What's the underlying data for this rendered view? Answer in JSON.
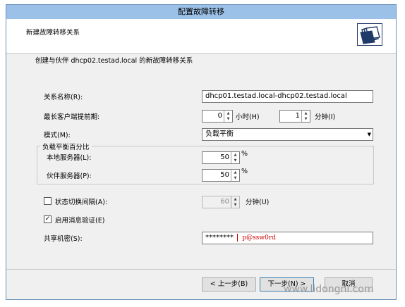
{
  "window": {
    "title": "配置故障转移"
  },
  "header": {
    "title": "新建故障转移关系",
    "icon": "folders-icon"
  },
  "description": "创建与伙伴 dhcp02.testad.local 的新故障转移关系",
  "relationship": {
    "label": "关系名称(R):",
    "value": "dhcp01.testad.local-dhcp02.testad.local"
  },
  "mclt": {
    "label": "最长客户端提前期:",
    "hours": "0",
    "hours_label": "小时(H)",
    "minutes": "1",
    "minutes_label": "分钟(I)"
  },
  "mode": {
    "label": "模式(M):",
    "value": "负载平衡"
  },
  "load_balance": {
    "title": "负载平衡百分比",
    "local_label": "本地服务器(L):",
    "local_value": "50",
    "partner_label": "伙伴服务器(P):",
    "partner_value": "50",
    "percent": "%"
  },
  "state_switch": {
    "checked": false,
    "label": "状态切换间隔(A):",
    "value": "60",
    "unit": "分钟(U)"
  },
  "message_auth": {
    "checked": true,
    "label": "启用消息验证(E)"
  },
  "shared_secret": {
    "label": "共享机密(S):",
    "masked": "********",
    "annotation": "p@ssw0rd"
  },
  "buttons": {
    "back": "< 上一步(B)",
    "next": "下一步(N) >",
    "cancel": "取消"
  },
  "watermark": "www.lidongni.com"
}
